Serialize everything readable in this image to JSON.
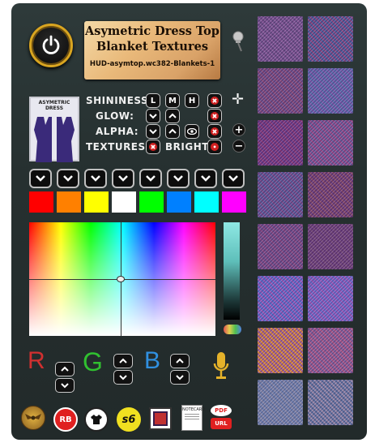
{
  "title": {
    "line1": "Asymetric Dress Top",
    "line2": "Blanket Textures",
    "line3": "HUD-asymtop.wc382-Blankets-1"
  },
  "preview": {
    "label": "ASYMETRIC DRESS"
  },
  "rows": {
    "shininess": {
      "label": "SHININESS:",
      "buttons": [
        "L",
        "M",
        "H"
      ]
    },
    "glow": {
      "label": "GLOW:"
    },
    "alpha": {
      "label": "ALPHA:"
    },
    "textures": {
      "label": "TEXTURES:"
    },
    "bright": {
      "label": "BRIGHT:"
    }
  },
  "swatches": [
    "#ff0000",
    "#ff8000",
    "#ffff00",
    "#ffffff",
    "#00ff00",
    "#0080ff",
    "#00ffff",
    "#ff00ff"
  ],
  "rgb": {
    "r": "R",
    "g": "G",
    "b": "B",
    "r_color": "#d03030",
    "g_color": "#30c030",
    "b_color": "#3090e0"
  },
  "bottom_icons": {
    "rb": "RB",
    "s6": "s6",
    "notecard": "NOTECARD",
    "pdf": "PDF",
    "url": "URL"
  },
  "textures": [
    {
      "a": "#6a4a8a",
      "b": "#8a5aa0"
    },
    {
      "a": "#8a4a8a",
      "b": "#4a5aa0"
    },
    {
      "a": "#8a4a80",
      "b": "#6a4a90"
    },
    {
      "a": "#5a6ab0",
      "b": "#7a5ab0"
    },
    {
      "a": "#8a3a80",
      "b": "#6a3a90"
    },
    {
      "a": "#9a4a90",
      "b": "#6a5aa0"
    },
    {
      "a": "#5a5aa0",
      "b": "#7a4a90"
    },
    {
      "a": "#8a4a70",
      "b": "#6a3a80"
    },
    {
      "a": "#8a4a8a",
      "b": "#6a4a90"
    },
    {
      "a": "#7a4a80",
      "b": "#6a3a80"
    },
    {
      "a": "#9a5ac0",
      "b": "#5a6ad0"
    },
    {
      "a": "#6a6ad0",
      "b": "#9a5ac0"
    },
    {
      "a": "#9a5aa0",
      "b": "#e08a40"
    },
    {
      "a": "#b05a90",
      "b": "#7a5aa0"
    },
    {
      "a": "#8a8ab0",
      "b": "#6a7ab0"
    },
    {
      "a": "#9a8ab0",
      "b": "#5a6aa0"
    }
  ]
}
